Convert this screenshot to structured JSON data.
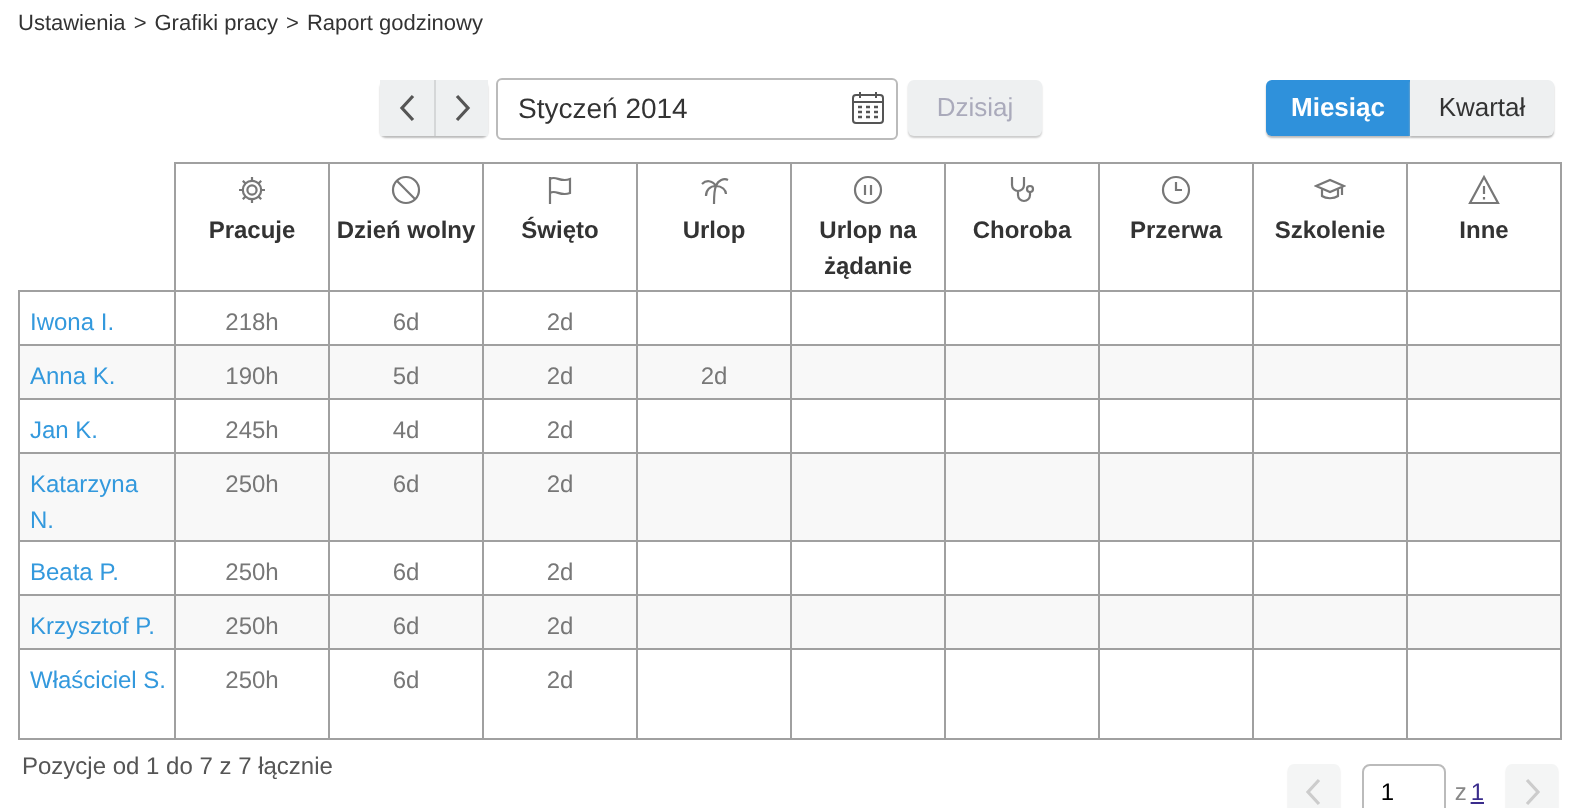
{
  "breadcrumb": [
    "Ustawienia",
    "Grafiki pracy",
    "Raport godzinowy"
  ],
  "breadcrumb_separator": ">",
  "toolbar": {
    "period": "Styczeń 2014",
    "today_button": {
      "label": "Dzisiaj",
      "disabled": true
    },
    "view_options": [
      {
        "label": "Miesiąc",
        "selected": true
      },
      {
        "label": "Kwartał",
        "selected": false
      }
    ]
  },
  "table": {
    "columns": [
      {
        "label": "Pracuje"
      },
      {
        "label": "Dzień wolny"
      },
      {
        "label": "Święto"
      },
      {
        "label": "Urlop"
      },
      {
        "label": "Urlop na żądanie"
      },
      {
        "label": "Choroba"
      },
      {
        "label": "Przerwa"
      },
      {
        "label": "Szkolenie"
      },
      {
        "label": "Inne"
      }
    ],
    "rows": [
      {
        "name": "Iwona I.",
        "cells": [
          "218h",
          "6d",
          "2d",
          null,
          null,
          null,
          null,
          null,
          null
        ]
      },
      {
        "name": "Anna K.",
        "cells": [
          "190h",
          "5d",
          "2d",
          "2d",
          null,
          null,
          null,
          null,
          null
        ]
      },
      {
        "name": "Jan K.",
        "cells": [
          "245h",
          "4d",
          "2d",
          null,
          null,
          null,
          null,
          null,
          null
        ]
      },
      {
        "name": "Katarzyna N.",
        "cells": [
          "250h",
          "6d",
          "2d",
          null,
          null,
          null,
          null,
          null,
          null
        ]
      },
      {
        "name": "Beata P.",
        "cells": [
          "250h",
          "6d",
          "2d",
          null,
          null,
          null,
          null,
          null,
          null
        ]
      },
      {
        "name": "Krzysztof P.",
        "cells": [
          "250h",
          "6d",
          "2d",
          null,
          null,
          null,
          null,
          null,
          null
        ]
      },
      {
        "name": "Właściciel S.",
        "cells": [
          "250h",
          "6d",
          "2d",
          null,
          null,
          null,
          null,
          null,
          null
        ]
      }
    ]
  },
  "summary": "Pozycje od 1 do 7 z 7 łącznie",
  "pagination": {
    "page": "1",
    "of_label": "z",
    "total_pages": "1",
    "prev_disabled": true,
    "next_disabled": true
  }
}
